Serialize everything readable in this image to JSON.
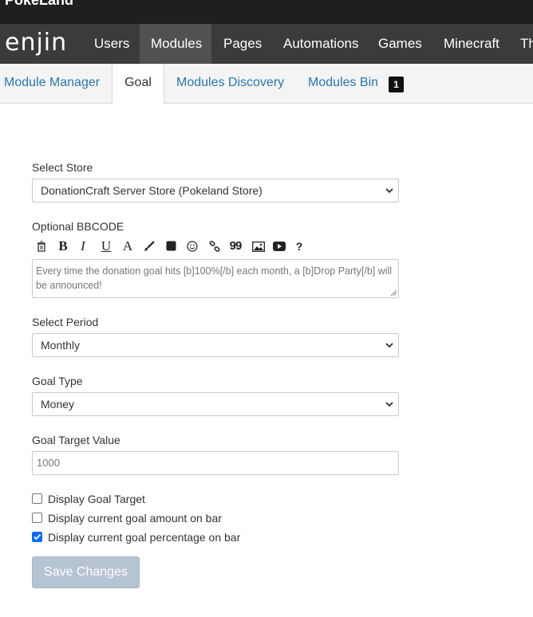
{
  "site": {
    "title": "PokeLand"
  },
  "nav": {
    "logo": "enjin",
    "items": [
      "Users",
      "Modules",
      "Pages",
      "Automations",
      "Games",
      "Minecraft",
      "Th"
    ]
  },
  "tabs": {
    "items": [
      "Module Manager",
      "Goal",
      "Modules Discovery",
      "Modules Bin"
    ],
    "bin_count": "1"
  },
  "form": {
    "store_label": "Select Store",
    "store_value": "DonationCraft Server Store (Pokeland Store)",
    "bbcode_label": "Optional BBCODE",
    "toolbar_icons": [
      "eraser-icon",
      "bold-icon",
      "italic-icon",
      "underline-icon",
      "font-icon",
      "brush-icon",
      "color-icon",
      "smiley-icon",
      "link-icon",
      "quote-icon",
      "image-icon",
      "video-icon",
      "help-icon"
    ],
    "toolbar_glyphs": {
      "bold": "B",
      "italic": "I",
      "underline": "U",
      "font": "A",
      "quote": "99",
      "help": "?"
    },
    "bbcode_value": "Every time the donation goal hits [b]100%[/b] each month, a [b]Drop Party[/b] will be announced!",
    "period_label": "Select Period",
    "period_value": "Monthly",
    "type_label": "Goal Type",
    "type_value": "Money",
    "target_label": "Goal Target Value",
    "target_placeholder": "1000",
    "checkboxes": [
      {
        "label": "Display Goal Target",
        "checked": false
      },
      {
        "label": "Display current goal amount on bar",
        "checked": false
      },
      {
        "label": "Display current goal percentage on bar",
        "checked": true
      }
    ],
    "save_label": "Save Changes"
  },
  "colors": {
    "link": "#2a77a9",
    "nav_bg": "#3a3b3d",
    "check_accent": "#0a6cf5",
    "button_disabled": "#b6c3d3"
  }
}
